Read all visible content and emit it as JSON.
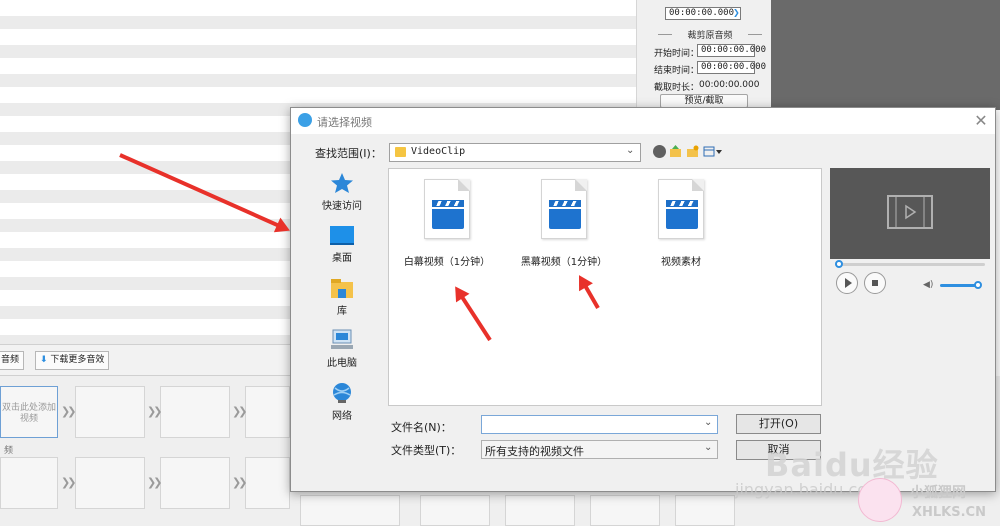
{
  "background_app": {
    "start_time_label": "开始时间：",
    "end_time_label": "结束时间：",
    "duration_label": "截取时长：",
    "position_value": "00:00:00.000",
    "start_value": "00:00:00.000",
    "end_value": "00:00:00.000",
    "duration_value": "00:00:00.000",
    "section_title": "裁剪原音频",
    "preview_button": "预览/截取",
    "audio_button": "音频",
    "download_button": "下载更多音效",
    "add_video_hint": "双击此处添加视频",
    "track_label": "频"
  },
  "dialog": {
    "title": "请选择视频",
    "lookin_label": "查找范围(I)：",
    "lookin_value": "VideoClip",
    "places": [
      {
        "label": "快速访问",
        "icon": "star-icon"
      },
      {
        "label": "桌面",
        "icon": "desktop-icon"
      },
      {
        "label": "库",
        "icon": "library-icon"
      },
      {
        "label": "此电脑",
        "icon": "computer-icon"
      },
      {
        "label": "网络",
        "icon": "network-icon"
      }
    ],
    "files": [
      {
        "name": "白幕视频（1分钟）",
        "icon": "video-file-icon"
      },
      {
        "name": "黑幕视频（1分钟）",
        "icon": "video-file-icon"
      },
      {
        "name": "视频素材",
        "icon": "video-file-icon"
      }
    ],
    "filename_label": "文件名(N)：",
    "filename_value": "",
    "filetype_label": "文件类型(T)：",
    "filetype_value": "所有支持的视频文件",
    "open_button": "打开(O)",
    "cancel_button": "取消"
  },
  "player": {
    "progress": 0,
    "volume": 0.85
  },
  "watermark": {
    "brand": "Baidu经验",
    "sub": "jingyan.baidu.com",
    "site_name": "小狐狸网",
    "site_url": "XHLKS.CN"
  },
  "colors": {
    "accent": "#2e8fe0",
    "file_icon_blue": "#1e73cf",
    "annotation_red": "#e8312a"
  }
}
